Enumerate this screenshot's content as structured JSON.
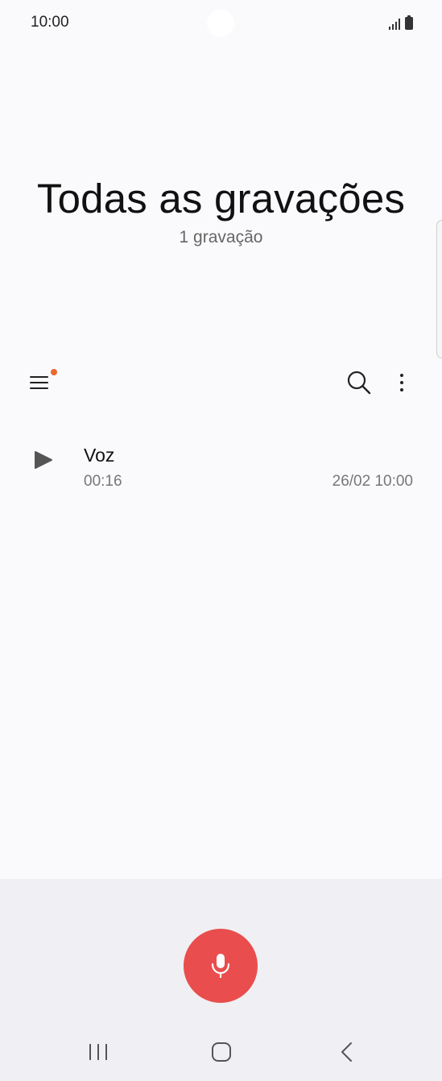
{
  "status_bar": {
    "time": "10:00",
    "icons": [
      "signal-icon",
      "battery-icon"
    ]
  },
  "header": {
    "title": "Todas as gravações",
    "subtitle": "1 gravação"
  },
  "toolbar": {
    "menu_icon": "hamburger-menu-icon",
    "has_notification": true,
    "notification_color": "#e9692d",
    "search_icon": "search-icon",
    "more_icon": "more-options-icon"
  },
  "recordings": [
    {
      "name": "Voz",
      "duration": "00:16",
      "date": "26/02 10:00",
      "icon": "play-icon"
    }
  ],
  "record_button": {
    "icon": "microphone-icon",
    "color": "#e94d4d"
  },
  "nav_bar": {
    "items": [
      "recent-apps-icon",
      "home-icon",
      "back-icon"
    ]
  }
}
